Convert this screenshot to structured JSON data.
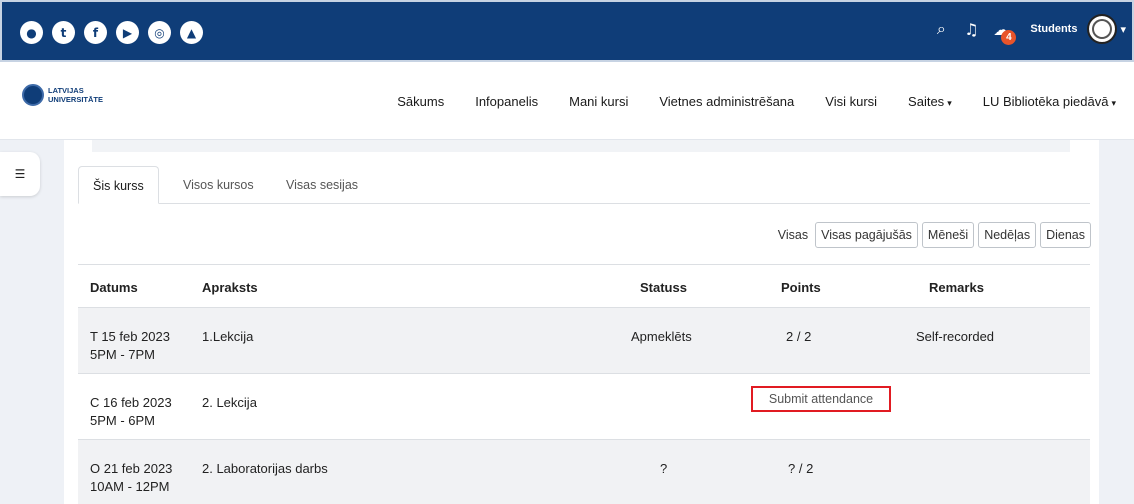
{
  "social_icons": [
    "globe-icon",
    "twitter-icon",
    "facebook-icon",
    "youtube-icon",
    "instagram-icon",
    "graduation-cap-icon"
  ],
  "topbar": {
    "user_name": "Students",
    "notifications_badge": "4",
    "colors": {
      "background": "#0f3d78",
      "badge": "#e8542a"
    }
  },
  "logo": {
    "line1": "LATVIJAS",
    "line2": "UNIVERSITĀTE"
  },
  "nav": {
    "items": [
      {
        "label": "Sākums",
        "dropdown": false
      },
      {
        "label": "Infopanelis",
        "dropdown": false
      },
      {
        "label": "Mani kursi",
        "dropdown": false
      },
      {
        "label": "Vietnes administrēšana",
        "dropdown": false
      },
      {
        "label": "Visi kursi",
        "dropdown": false
      },
      {
        "label": "Saites",
        "dropdown": true
      },
      {
        "label": "LU Bibliotēka piedāvā",
        "dropdown": true
      }
    ]
  },
  "tabs": [
    {
      "label": "Šis kurss",
      "active": true
    },
    {
      "label": "Visos kursos",
      "active": false
    },
    {
      "label": "Visas sesijas",
      "active": false
    }
  ],
  "filters": {
    "label": "Visas",
    "buttons": [
      "Visas pagājušās",
      "Mēneši",
      "Nedēļas",
      "Dienas"
    ]
  },
  "table": {
    "headers": {
      "date": "Datums",
      "description": "Apraksts",
      "status": "Statuss",
      "points": "Points",
      "remarks": "Remarks"
    },
    "rows": [
      {
        "date": "T 15 feb 2023",
        "time": "5PM - 7PM",
        "description": "1.Lekcija",
        "status": "Apmeklēts",
        "points": "2 / 2",
        "remarks": "Self-recorded"
      },
      {
        "date": "C 16 feb 2023",
        "time": "5PM - 6PM",
        "description": "2. Lekcija",
        "status": "",
        "points": "Submit attendance",
        "remarks": ""
      },
      {
        "date": "O 21 feb 2023",
        "time": "10AM - 12PM",
        "description": "2. Laboratorijas darbs",
        "status": "?",
        "points": "? / 2",
        "remarks": ""
      }
    ]
  },
  "highlight_color": "#e11b22"
}
